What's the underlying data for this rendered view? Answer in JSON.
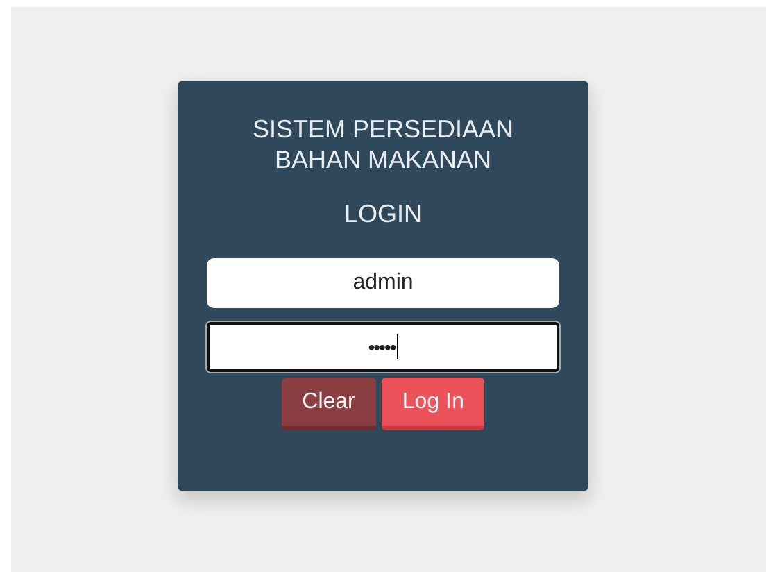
{
  "title": "SISTEM PERSEDIAAN\nBAHAN MAKANAN",
  "heading": "LOGIN",
  "fields": [
    {
      "kind": "text",
      "value": "admin",
      "focused": false
    },
    {
      "kind": "password",
      "value": "•••••",
      "focused": true
    }
  ],
  "buttons": [
    {
      "label": "Clear",
      "kind": "secondary"
    },
    {
      "label": "Log In",
      "kind": "primary"
    }
  ]
}
